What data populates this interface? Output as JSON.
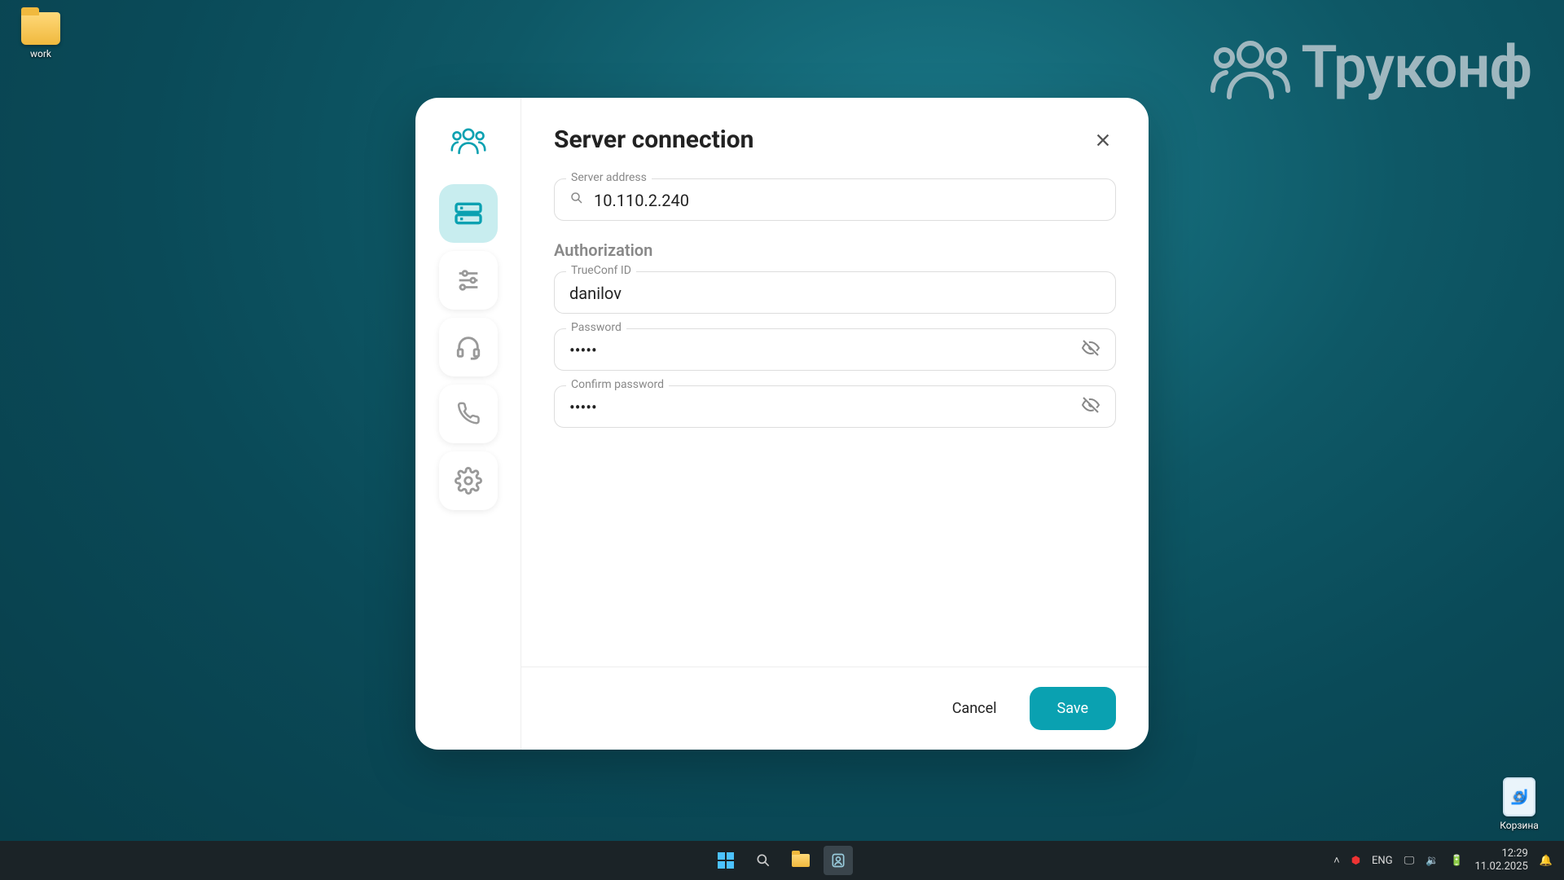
{
  "desktop": {
    "folder_label": "work",
    "recycle_label": "Корзина"
  },
  "watermark": {
    "text": "Труконф"
  },
  "dialog": {
    "title": "Server connection",
    "server_label": "Server address",
    "server_value": "10.110.2.240",
    "auth_section": "Authorization",
    "id_label": "TrueConf ID",
    "id_value": "danilov",
    "password_label": "Password",
    "password_value": "•••••",
    "confirm_label": "Confirm password",
    "confirm_value": "•••••",
    "cancel": "Cancel",
    "save": "Save"
  },
  "taskbar": {
    "lang": "ENG",
    "time": "12:29",
    "date": "11.02.2025"
  }
}
